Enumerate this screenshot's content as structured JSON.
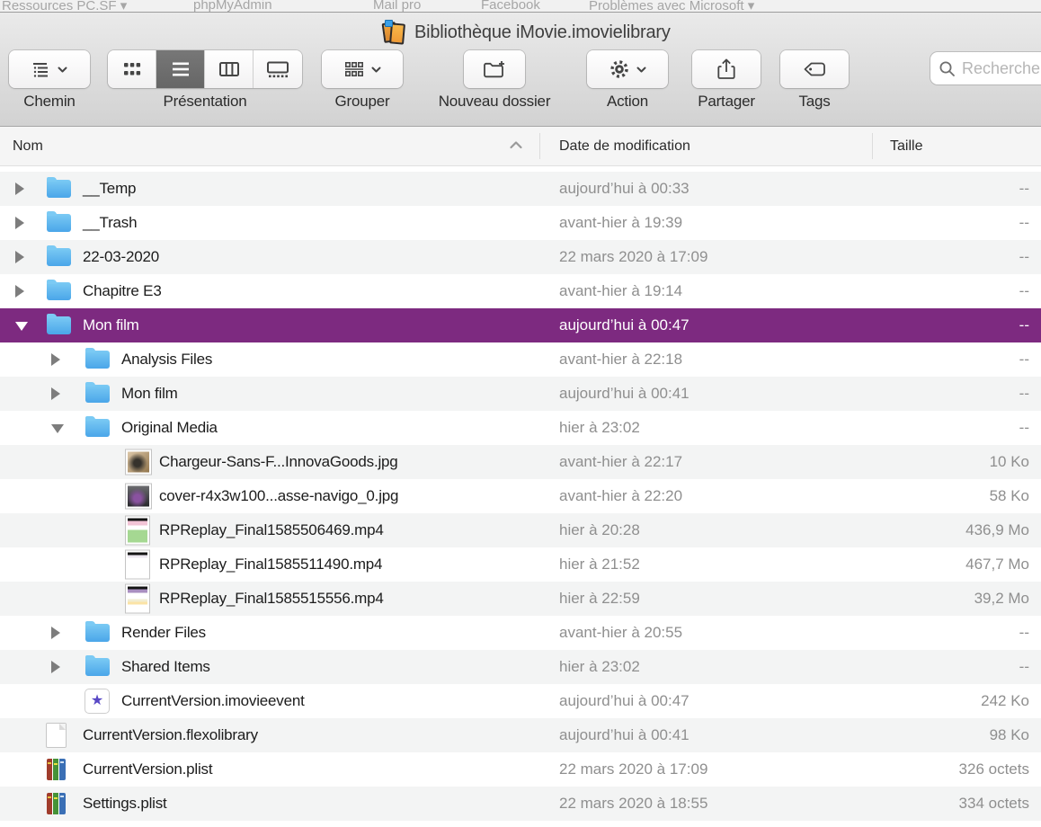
{
  "background_tabs": {
    "items": [
      "Ressources PC.SF ▾",
      "phpMyAdmin",
      "Mail pro",
      "Facebook",
      "Problèmes avec Microsoft ▾"
    ]
  },
  "window": {
    "title": "Bibliothèque iMovie.imovielibrary"
  },
  "toolbar": {
    "chemin_label": "Chemin",
    "presentation_label": "Présentation",
    "grouper_label": "Grouper",
    "nouveau_dossier_label": "Nouveau dossier",
    "action_label": "Action",
    "partager_label": "Partager",
    "tags_label": "Tags",
    "search_placeholder": "Rechercher"
  },
  "columns": {
    "name": "Nom",
    "date": "Date de modification",
    "size": "Taille"
  },
  "rows": [
    {
      "name": "__Temp",
      "date": "aujourd’hui à 00:33",
      "size": "--",
      "level": 1,
      "type": "folder",
      "disclosure": "collapsed",
      "selected": false
    },
    {
      "name": "__Trash",
      "date": "avant-hier à 19:39",
      "size": "--",
      "level": 1,
      "type": "folder",
      "disclosure": "collapsed",
      "selected": false
    },
    {
      "name": "22-03-2020",
      "date": "22 mars 2020 à 17:09",
      "size": "--",
      "level": 1,
      "type": "folder",
      "disclosure": "collapsed",
      "selected": false
    },
    {
      "name": "Chapitre E3",
      "date": "avant-hier à 19:14",
      "size": "--",
      "level": 1,
      "type": "folder",
      "disclosure": "collapsed",
      "selected": false
    },
    {
      "name": "Mon film",
      "date": "aujourd’hui à 00:47",
      "size": "--",
      "level": 1,
      "type": "folder",
      "disclosure": "expanded",
      "selected": true
    },
    {
      "name": "Analysis Files",
      "date": "avant-hier à 22:18",
      "size": "--",
      "level": 2,
      "type": "folder",
      "disclosure": "collapsed",
      "selected": false
    },
    {
      "name": "Mon film",
      "date": "aujourd’hui à 00:41",
      "size": "--",
      "level": 2,
      "type": "folder",
      "disclosure": "collapsed",
      "selected": false
    },
    {
      "name": "Original Media",
      "date": "hier à 23:02",
      "size": "--",
      "level": 2,
      "type": "folder",
      "disclosure": "expanded",
      "selected": false
    },
    {
      "name": "Chargeur-Sans-F...InnovaGoods.jpg",
      "date": "avant-hier à 22:17",
      "size": "10 Ko",
      "level": 3,
      "type": "jpg-chargeur",
      "disclosure": "none",
      "selected": false
    },
    {
      "name": "cover-r4x3w100...asse-navigo_0.jpg",
      "date": "avant-hier à 22:20",
      "size": "58 Ko",
      "level": 3,
      "type": "jpg-cover",
      "disclosure": "none",
      "selected": false
    },
    {
      "name": "RPReplay_Final1585506469.mp4",
      "date": "hier à 20:28",
      "size": "436,9 Mo",
      "level": 3,
      "type": "mp4-1",
      "disclosure": "none",
      "selected": false
    },
    {
      "name": "RPReplay_Final1585511490.mp4",
      "date": "hier à 21:52",
      "size": "467,7 Mo",
      "level": 3,
      "type": "mp4-2",
      "disclosure": "none",
      "selected": false
    },
    {
      "name": "RPReplay_Final1585515556.mp4",
      "date": "hier à 22:59",
      "size": "39,2 Mo",
      "level": 3,
      "type": "mp4-3",
      "disclosure": "none",
      "selected": false
    },
    {
      "name": "Render Files",
      "date": "avant-hier à 20:55",
      "size": "--",
      "level": 2,
      "type": "folder",
      "disclosure": "collapsed",
      "selected": false
    },
    {
      "name": "Shared Items",
      "date": "hier à 23:02",
      "size": "--",
      "level": 2,
      "type": "folder",
      "disclosure": "collapsed",
      "selected": false
    },
    {
      "name": "CurrentVersion.imovieevent",
      "date": "aujourd’hui à 00:47",
      "size": "242 Ko",
      "level": 2,
      "type": "imovie-event",
      "disclosure": "none",
      "selected": false
    },
    {
      "name": "CurrentVersion.flexolibrary",
      "date": "aujourd’hui à 00:41",
      "size": "98 Ko",
      "level": 1,
      "type": "flexo-doc",
      "disclosure": "none",
      "selected": false
    },
    {
      "name": "CurrentVersion.plist",
      "date": "22 mars 2020 à 17:09",
      "size": "326 octets",
      "level": 1,
      "type": "plist",
      "disclosure": "none",
      "selected": false
    },
    {
      "name": "Settings.plist",
      "date": "22 mars 2020 à 18:55",
      "size": "334 octets",
      "level": 1,
      "type": "plist",
      "disclosure": "none",
      "selected": false
    }
  ],
  "colors": {
    "selection": "#7d2a80",
    "folder_blue": "#4aa6e9",
    "chrome_top": "#eaeaea",
    "chrome_bottom": "#d2d2d2",
    "alt_row": "#f3f4f4"
  }
}
